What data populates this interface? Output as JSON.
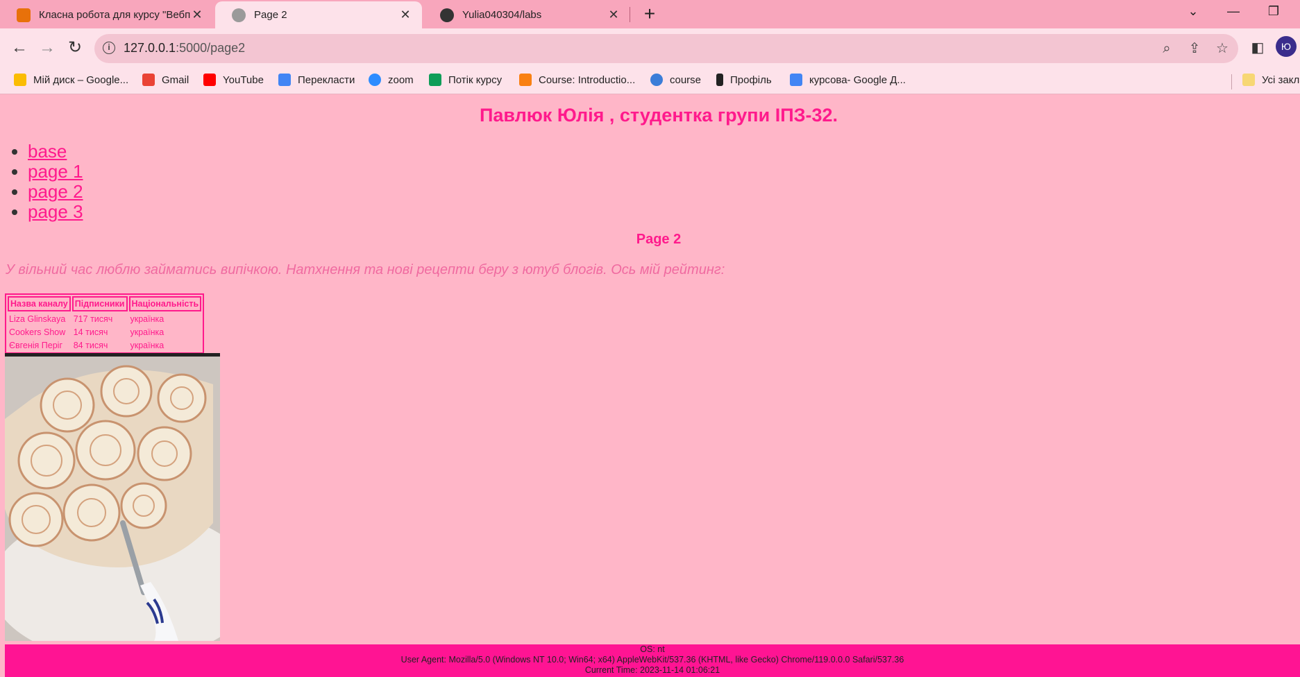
{
  "browser": {
    "tabs": [
      {
        "title": "Класна робота для курсу \"Вебп",
        "favicon_color": "#e8710a"
      },
      {
        "title": "Page 2",
        "favicon_color": "#7a7a7a"
      },
      {
        "title": "Yulia040304/labs",
        "favicon_color": "#333333"
      }
    ],
    "new_tab": "+",
    "url_host": "127.0.0.1",
    "url_path": ":5000/page2",
    "profile_initial": "Ю",
    "bookmarks": [
      {
        "label": "Мій диск – Google...",
        "icon": "google-drive-icon",
        "color": "#fbbc04"
      },
      {
        "label": "Gmail",
        "icon": "gmail-icon",
        "color": "#ea4335"
      },
      {
        "label": "YouTube",
        "icon": "youtube-icon",
        "color": "#ff0000"
      },
      {
        "label": "Перекласти",
        "icon": "translate-icon",
        "color": "#4285f4"
      },
      {
        "label": "zoom",
        "icon": "zoom-icon",
        "color": "#2d8cff"
      },
      {
        "label": "Потік курсу",
        "icon": "classroom-icon",
        "color": "#0f9d58"
      },
      {
        "label": "Course: Introductio...",
        "icon": "moodle-icon",
        "color": "#f98012"
      },
      {
        "label": "course",
        "icon": "course-icon",
        "color": "#3b7dd8"
      },
      {
        "label": "Профіль",
        "icon": "profile-icon",
        "color": "#222222"
      },
      {
        "label": "курсова- Google Д...",
        "icon": "google-docs-icon",
        "color": "#4285f4"
      }
    ],
    "all_bookmarks": "Усі закла"
  },
  "page": {
    "title": "Павлюк Юлія , студентка групи ІПЗ-32.",
    "nav": [
      {
        "label": "base"
      },
      {
        "label": "page 1"
      },
      {
        "label": "page 2"
      },
      {
        "label": "page 3"
      }
    ],
    "subtitle": "Page 2",
    "intro": "У вільний час люблю займатись випічкою. Натхнення та нові рецепти беру з ютуб блогів. Ось мій рейтинг:",
    "table": {
      "headers": [
        "Назва каналу",
        "Підписники",
        "Національність"
      ],
      "rows": [
        [
          "Liza Glinskaya",
          "717 тисяч",
          "українка"
        ],
        [
          "Cookers Show",
          "14 тисяч",
          "українка"
        ],
        [
          "Євгенія Періг",
          "84 тисяч",
          "українка"
        ]
      ]
    },
    "footer": {
      "os": "OS: nt",
      "user_agent": "User Agent: Mozilla/5.0 (Windows NT 10.0; Win64; x64) AppleWebKit/537.36 (KHTML, like Gecko) Chrome/119.0.0.0 Safari/537.36",
      "current_time": "Current Time: 2023-11-14 01:06:21"
    }
  },
  "colors": {
    "accent": "#ff1a8c",
    "page_bg": "#ffb6c8",
    "footer_bg": "#ff1493",
    "chrome_bg": "#fde2ea"
  }
}
